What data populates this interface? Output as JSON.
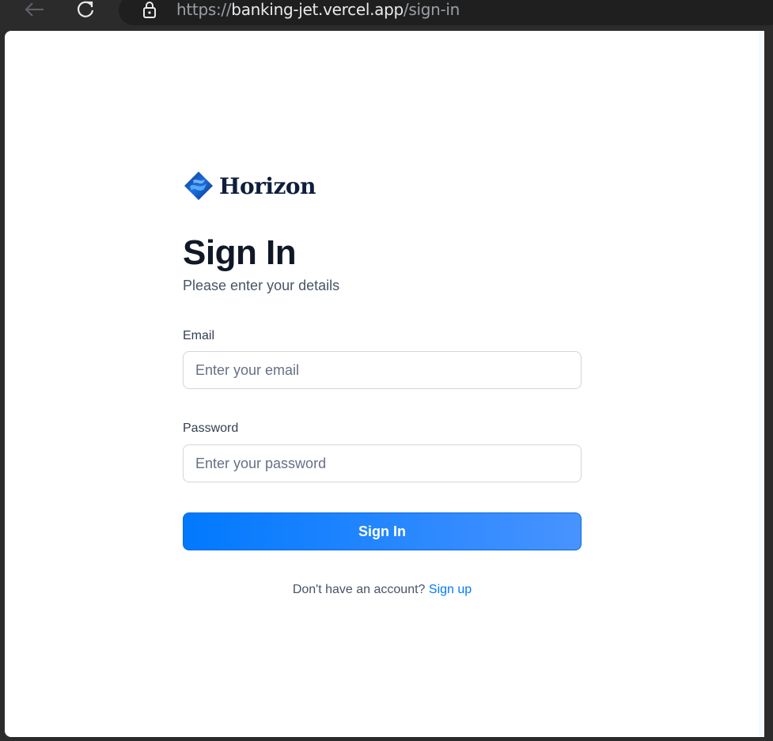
{
  "browser": {
    "url_scheme": "https://",
    "url_host": "banking-jet.vercel.app",
    "url_path": "/sign-in"
  },
  "brand": {
    "name": "Horizon",
    "logo_icon": "horizon-logo-icon",
    "accent_color": "#0179fe"
  },
  "auth": {
    "title": "Sign In",
    "subtitle": "Please enter your details",
    "email": {
      "label": "Email",
      "placeholder": "Enter your email",
      "value": ""
    },
    "password": {
      "label": "Password",
      "placeholder": "Enter your password",
      "value": ""
    },
    "submit_label": "Sign In",
    "footer_text": "Don't have an account?",
    "footer_link": "Sign up"
  }
}
